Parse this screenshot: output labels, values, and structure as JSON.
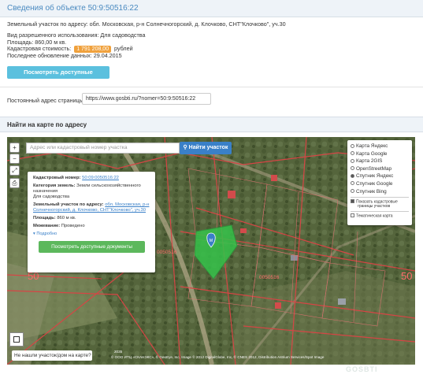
{
  "header": {
    "title": "Сведения об объекте 50:9:50516:22"
  },
  "info": {
    "address_label": "Земельный участок по адресу:",
    "address": "обл. Московская, р-н Солнечногорский, д. Клочково, СНТ\"Клочково\", уч.30",
    "use_label": "Вид разрешенного использования:",
    "use": "Для садоводства",
    "area_label": "Площадь:",
    "area": "860,00 м кв.",
    "cost_label": "Кадастровая стоимость:",
    "cost": "1 791 208,00",
    "cost_unit": "рублей",
    "updated_label": "Последнее обновление данных:",
    "updated": "29.04.2015",
    "docs_button": "Посмотреть доступные документы"
  },
  "permalink": {
    "label": "Постоянный адрес страницы:",
    "url": "https://www.gosbti.ru/?nomer=50:9:50516:22"
  },
  "map_section": {
    "title": "Найти на карте по адресу",
    "search_placeholder": "Адрес или кадастровый номер участка",
    "search_button": "Найти участок",
    "popup": {
      "cad_label": "Кадастровый номер:",
      "cad_value": "50:09:0050516:22",
      "category_label": "Категория земель:",
      "category_value": "Земли сельскохозяйственного назначения",
      "use_value": "Для садоводства",
      "address_label": "Земельный участок по адресу:",
      "address_value": "обл. Московская, р-н Солнечногорский, д. Клочково, СНТ\"Клочково\", уч.30",
      "area_label": "Площадь:",
      "area_value": "860 м кв.",
      "survey_label": "Межевание:",
      "survey_value": "Проведено",
      "more": "Подробно",
      "docs_button": "Посмотреть доступные документы"
    },
    "layers": {
      "options": [
        {
          "label": "Карта Яндекс",
          "selected": false
        },
        {
          "label": "Карта Google",
          "selected": false
        },
        {
          "label": "Карта 2GIS",
          "selected": false
        },
        {
          "label": "OpenStreetMap",
          "selected": false
        },
        {
          "label": "Спутник Яндекс",
          "selected": true
        },
        {
          "label": "Спутник Google",
          "selected": false
        },
        {
          "label": "Спутник Bing",
          "selected": false
        }
      ],
      "show_borders_1": "Показать кадастровые",
      "show_borders_2": "границы участков",
      "thematic": "Тематическая карта"
    },
    "map_labels": {
      "block_code_1": "0050516",
      "block_code_2": "0050516",
      "big_50_left": "50",
      "big_50_right": "50",
      "marker": "M"
    },
    "not_found": "Не нашли участок/дом на карте?",
    "copyright": "© ООО ИТЦ «СКАНЭКС», © GeoEye, Inc, Image © 2012 DigitalGlobe, Inc, © CNES 2012, Distribution Astrium Services/Spot Image",
    "scale_label": "2035"
  },
  "watermark": "GOSBTI"
}
